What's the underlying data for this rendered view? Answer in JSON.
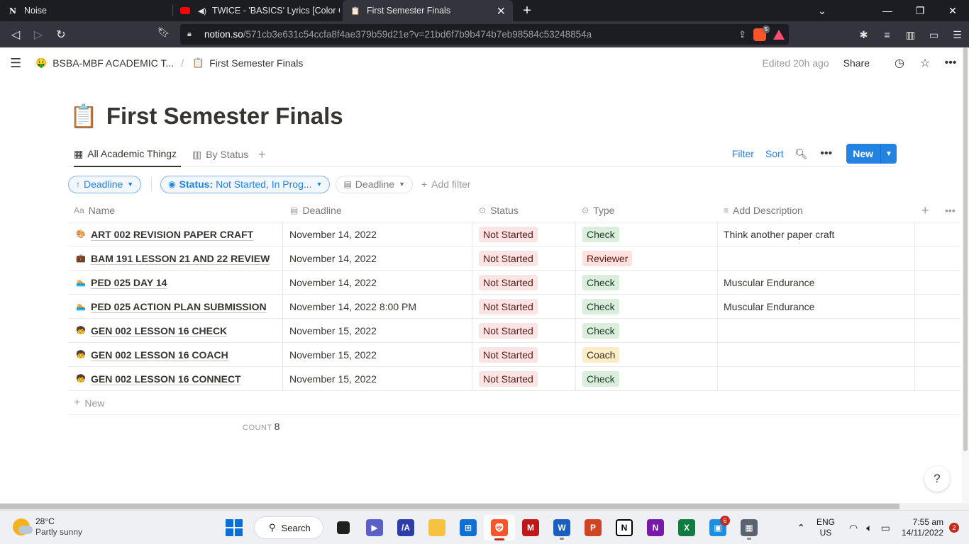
{
  "browser": {
    "tabs": [
      {
        "title": "Noise",
        "icon": "notion-icon"
      },
      {
        "title": "TWICE - 'BASICS' Lyrics [Color Cod",
        "icon": "youtube-icon",
        "audio": true
      },
      {
        "title": "First Semester Finals",
        "icon": "clipboard-icon",
        "active": true
      }
    ],
    "url_host": "notion.so",
    "url_path": "/571cb3e631c54ccfa8f4ae379b59d21e?v=21bd6f7b9b474b7eb98584c53248854a",
    "shields_count": "5"
  },
  "notion": {
    "breadcrumb": {
      "workspace": "BSBA-MBF ACADEMIC T...",
      "workspace_emoji": "🤑",
      "page": "First Semester Finals",
      "page_emoji": "📋",
      "separator": "/"
    },
    "edited": "Edited 20h ago",
    "share": "Share"
  },
  "page": {
    "icon": "📋",
    "title": "First Semester Finals"
  },
  "views": {
    "tabs": [
      {
        "label": "All Academic Thingz",
        "icon": "table-icon",
        "active": true
      },
      {
        "label": "By Status",
        "icon": "board-icon",
        "active": false
      }
    ],
    "filter": "Filter",
    "sort": "Sort",
    "new": "New"
  },
  "filters": {
    "sort_pill": "Deadline",
    "status_label": "Status:",
    "status_value": "Not Started, In Prog...",
    "deadline_pill": "Deadline",
    "add_filter": "Add filter"
  },
  "table": {
    "headers": {
      "name": "Name",
      "deadline": "Deadline",
      "status": "Status",
      "type": "Type",
      "description": "Add Description",
      "name_icon": "Aa"
    },
    "rows": [
      {
        "icon": "🎨",
        "name": "ART 002 REVISION PAPER CRAFT",
        "deadline": "November 14, 2022",
        "status": "Not Started",
        "type": "Check",
        "type_class": "check",
        "description": "Think another paper craft"
      },
      {
        "icon": "💼",
        "name": "BAM 191 LESSON 21 AND 22 REVIEW",
        "deadline": "November 14, 2022",
        "status": "Not Started",
        "type": "Reviewer",
        "type_class": "reviewer",
        "description": ""
      },
      {
        "icon": "🏊",
        "name": "PED 025 DAY 14",
        "deadline": "November 14, 2022",
        "status": "Not Started",
        "type": "Check",
        "type_class": "check",
        "description": "Muscular Endurance"
      },
      {
        "icon": "🏊",
        "name": "PED 025 ACTION PLAN SUBMISSION",
        "deadline": "November 14, 2022 8:00 PM",
        "status": "Not Started",
        "type": "Check",
        "type_class": "check",
        "description": "Muscular Endurance"
      },
      {
        "icon": "🧒",
        "name": "GEN 002 LESSON 16 CHECK",
        "deadline": "November 15, 2022",
        "status": "Not Started",
        "type": "Check",
        "type_class": "check",
        "description": ""
      },
      {
        "icon": "🧒",
        "name": "GEN 002 LESSON 16 COACH",
        "deadline": "November 15, 2022",
        "status": "Not Started",
        "type": "Coach",
        "type_class": "coach",
        "description": ""
      },
      {
        "icon": "🧒",
        "name": "GEN 002 LESSON 16 CONNECT",
        "deadline": "November 15, 2022",
        "status": "Not Started",
        "type": "Check",
        "type_class": "check",
        "description": ""
      }
    ],
    "new_row": "New",
    "count_label": "COUNT",
    "count_value": "8"
  },
  "help": "?",
  "taskbar": {
    "weather_temp": "28°C",
    "weather_desc": "Partly sunny",
    "search": "Search",
    "lang1": "ENG",
    "lang2": "US",
    "time": "7:55 am",
    "date": "14/11/2022",
    "notif_count": "2",
    "teams_badge": "6"
  },
  "colors": {
    "accent": "#2383e2",
    "status_not_started_bg": "#fbe4e4",
    "check_bg": "#dbeddb",
    "reviewer_bg": "#ffe2dd",
    "coach_bg": "#fdecc8"
  }
}
